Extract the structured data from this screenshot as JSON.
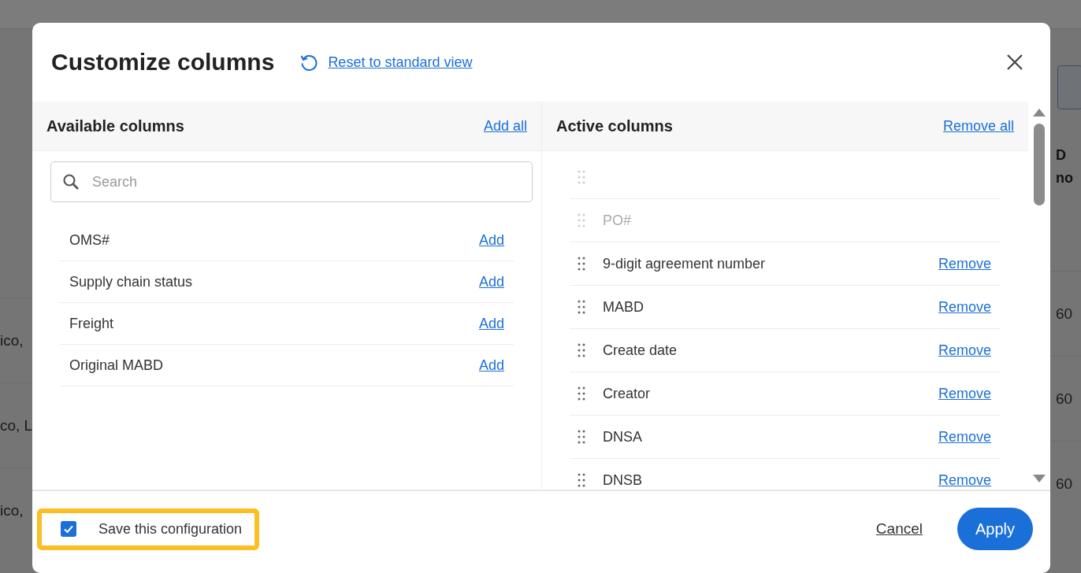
{
  "background_page": {
    "left_cells": [
      "ico,",
      "co, L",
      "ico,"
    ],
    "right_header": [
      "D",
      "no"
    ],
    "right_cells": [
      "60",
      "60",
      "60"
    ]
  },
  "dialog": {
    "title": "Customize columns",
    "reset_link": "Reset to standard view",
    "available": {
      "heading": "Available columns",
      "add_all": "Add all",
      "search": {
        "placeholder": "Search"
      },
      "items": [
        {
          "label": "OMS#",
          "action": "Add"
        },
        {
          "label": "Supply chain status",
          "action": "Add"
        },
        {
          "label": "Freight",
          "action": "Add"
        },
        {
          "label": "Original MABD",
          "action": "Add"
        }
      ]
    },
    "active": {
      "heading": "Active columns",
      "remove_all": "Remove all",
      "items": [
        {
          "disabled": true
        },
        {
          "label": "PO#",
          "disabled": true
        },
        {
          "label": "9-digit agreement number",
          "action": "Remove",
          "disabled": false
        },
        {
          "label": "MABD",
          "action": "Remove",
          "disabled": false
        },
        {
          "label": "Create date",
          "action": "Remove",
          "disabled": false
        },
        {
          "label": "Creator",
          "action": "Remove",
          "disabled": false
        },
        {
          "label": "DNSA",
          "action": "Remove",
          "disabled": false
        },
        {
          "label": "DNSB",
          "action": "Remove",
          "disabled": false
        }
      ]
    },
    "footer": {
      "save_config": {
        "label": "Save this configuration",
        "checked": true,
        "highlighted": true
      },
      "cancel": "Cancel",
      "apply": "Apply"
    }
  }
}
